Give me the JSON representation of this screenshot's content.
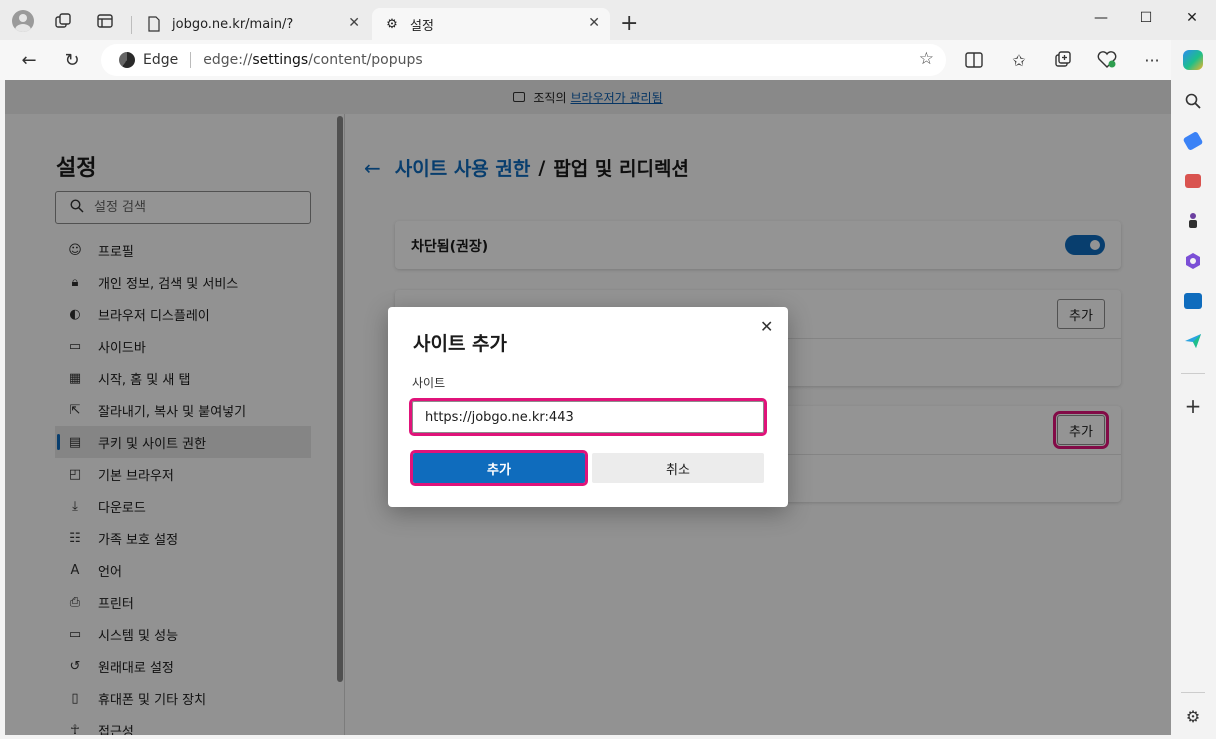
{
  "tabs": [
    {
      "title": "jobgo.ne.kr/main/?",
      "icon": "page-icon"
    },
    {
      "title": "설정",
      "icon": "gear-icon",
      "active": true
    }
  ],
  "address": {
    "scheme_label": "Edge",
    "url_prefix": "edge://",
    "url_highlight": "settings",
    "url_suffix": "/content/popups"
  },
  "managed_bar": {
    "text": "조직의",
    "link": "브라우저가 관리됨"
  },
  "sidebar": {
    "title": "설정",
    "search_placeholder": "설정 검색",
    "items": [
      {
        "label": "프로필",
        "icon": "profile-icon"
      },
      {
        "label": "개인 정보, 검색 및 서비스",
        "icon": "lock-icon"
      },
      {
        "label": "브라우저 디스플레이",
        "icon": "palette-icon"
      },
      {
        "label": "사이드바",
        "icon": "sidebar-icon"
      },
      {
        "label": "시작, 홈 및 새 탭",
        "icon": "home-grid-icon"
      },
      {
        "label": "잘라내기, 복사 및 붙여넣기",
        "icon": "share-icon"
      },
      {
        "label": "쿠키 및 사이트 권한",
        "icon": "cookie-icon",
        "active": true
      },
      {
        "label": "기본 브라우저",
        "icon": "browser-icon"
      },
      {
        "label": "다운로드",
        "icon": "download-icon"
      },
      {
        "label": "가족 보호 설정",
        "icon": "family-icon"
      },
      {
        "label": "언어",
        "icon": "language-icon"
      },
      {
        "label": "프린터",
        "icon": "printer-icon"
      },
      {
        "label": "시스템 및 성능",
        "icon": "laptop-icon"
      },
      {
        "label": "원래대로 설정",
        "icon": "reset-icon"
      },
      {
        "label": "휴대폰 및 기타 장치",
        "icon": "phone-icon"
      },
      {
        "label": "접근성",
        "icon": "accessibility-icon"
      }
    ]
  },
  "main": {
    "breadcrumb_link": "사이트 사용 권한",
    "breadcrumb_sep": "/",
    "breadcrumb_current": "팝업 및 리디렉션",
    "blocked_label": "차단됨(권장)",
    "blocked_toggle_on": true,
    "add_label_block": "추가",
    "add_label_allow": "추가"
  },
  "dialog": {
    "title": "사이트 추가",
    "field_label": "사이트",
    "field_value": "https://jobgo.ne.kr:443",
    "add_label": "추가",
    "cancel_label": "취소"
  },
  "colors": {
    "accent": "#0f6cbd",
    "highlight": "#e0137a"
  }
}
